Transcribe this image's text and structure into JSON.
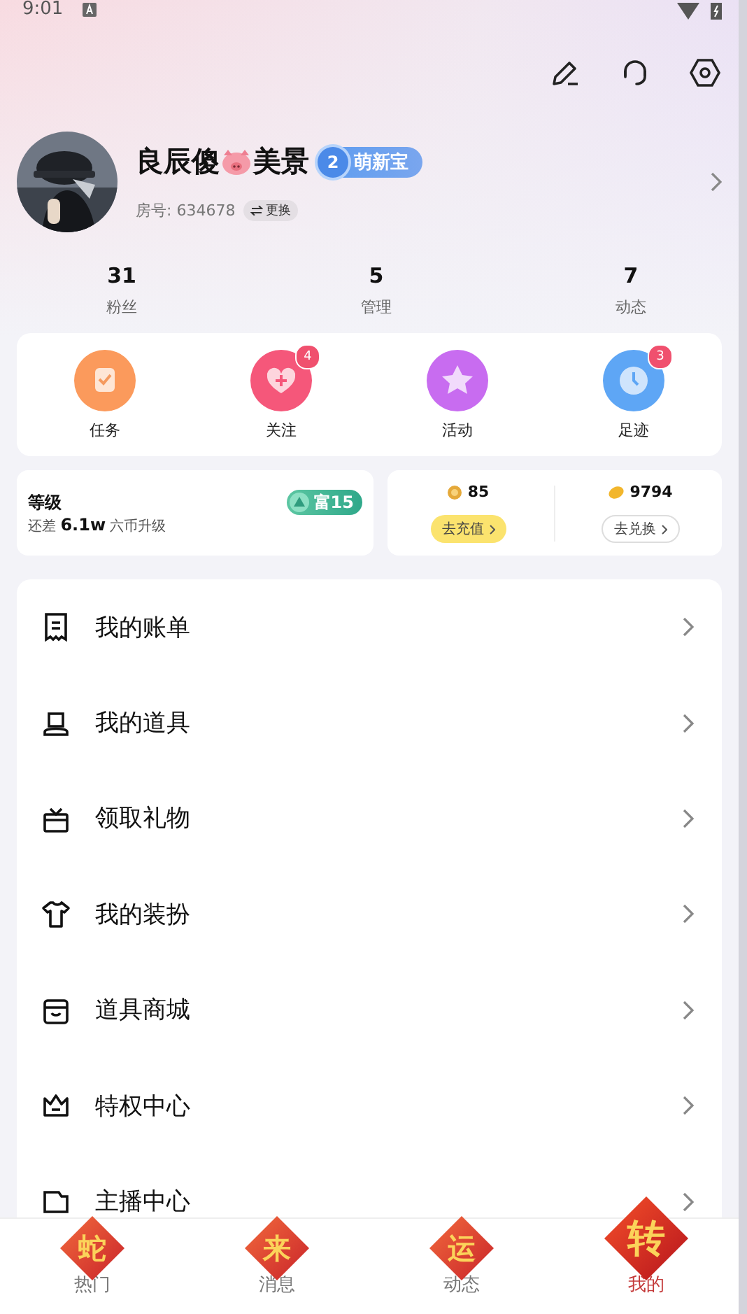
{
  "status_bar": {
    "time": "9:01"
  },
  "profile": {
    "name_before": "良辰傻",
    "name_after": "美景",
    "level_badge": {
      "number": "2",
      "label": "萌新宝"
    },
    "room_label": "房号: 634678",
    "switch_label": "更换"
  },
  "stats": [
    {
      "value": "31",
      "label": "粉丝"
    },
    {
      "value": "5",
      "label": "管理"
    },
    {
      "value": "7",
      "label": "动态"
    }
  ],
  "quick_actions": [
    {
      "label": "任务",
      "color": "#fb9a5c"
    },
    {
      "label": "关注",
      "color": "#f5577a",
      "badge": "4"
    },
    {
      "label": "活动",
      "color": "#c86cf0"
    },
    {
      "label": "足迹",
      "color": "#5ea6f5",
      "badge": "3"
    }
  ],
  "level_card": {
    "title": "等级",
    "rank": "富15",
    "hint": "还差 **6.1w** 六币升级"
  },
  "wallet": [
    {
      "amount": "85",
      "button": "去充值",
      "kind": "coin"
    },
    {
      "amount": "9794",
      "button": "去兑换",
      "kind": "bean"
    }
  ],
  "menu": [
    {
      "label": "我的账单"
    },
    {
      "label": "我的道具"
    },
    {
      "label": "领取礼物"
    },
    {
      "label": "我的装扮"
    },
    {
      "label": "道具商城"
    },
    {
      "label": "特权中心"
    },
    {
      "label": "主播中心"
    }
  ],
  "tab_bar": [
    {
      "emblem": "蛇",
      "label": "热门",
      "selected": false
    },
    {
      "emblem": "来",
      "label": "消息",
      "selected": false
    },
    {
      "emblem": "运",
      "label": "动态",
      "selected": false
    },
    {
      "emblem": "转",
      "label": "我的",
      "selected": true
    }
  ]
}
